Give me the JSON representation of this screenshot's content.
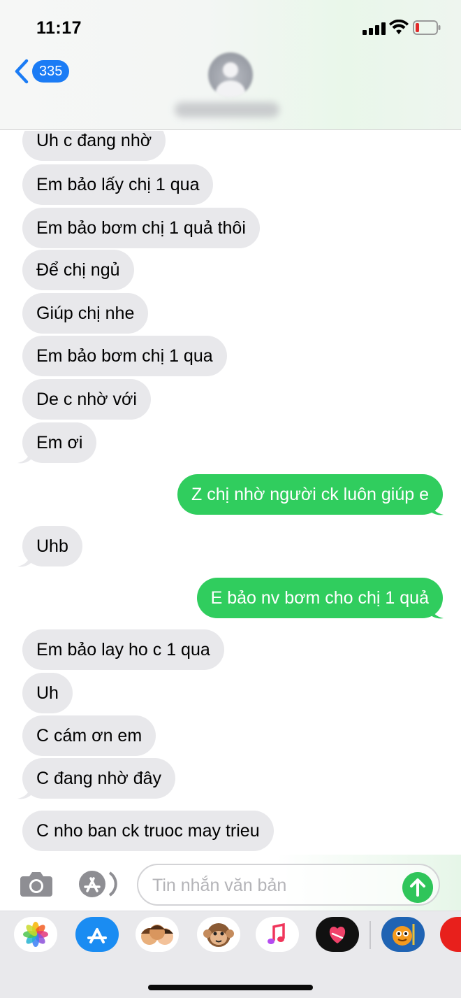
{
  "status_bar": {
    "time": "11:17"
  },
  "nav": {
    "unread_count": "335",
    "contact_name": ""
  },
  "messages": [
    {
      "text": "Uh c đang nhờ",
      "direction": "in"
    },
    {
      "text": "Em bảo lấy chị 1 qua",
      "direction": "in"
    },
    {
      "text": "Em bảo bơm chị 1 quả thôi",
      "direction": "in"
    },
    {
      "text": "Để chị ngủ",
      "direction": "in"
    },
    {
      "text": "Giúp chị nhe",
      "direction": "in"
    },
    {
      "text": "Em bảo bơm chị 1 qua",
      "direction": "in"
    },
    {
      "text": "De c nhờ với",
      "direction": "in"
    },
    {
      "text": "Em ơi",
      "direction": "in"
    },
    {
      "text": "Z chị nhờ người ck luôn giúp e",
      "direction": "out"
    },
    {
      "text": "Uhb",
      "direction": "in"
    },
    {
      "text": "E bảo nv bơm cho chị 1 quả",
      "direction": "out"
    },
    {
      "text": "Em bảo lay ho c 1 qua",
      "direction": "in"
    },
    {
      "text": "Uh",
      "direction": "in"
    },
    {
      "text": "C cám ơn em",
      "direction": "in"
    },
    {
      "text": "C đang nhờ đây",
      "direction": "in"
    },
    {
      "text": "C nho ban ck truoc may trieu",
      "direction": "in"
    }
  ],
  "composer": {
    "placeholder": "Tin nhắn văn bản"
  },
  "app_drawer": [
    "photos-app",
    "app-store-app",
    "memoji-app",
    "animoji-app",
    "music-app",
    "digital-touch-app",
    "game-app",
    "more-app"
  ],
  "colors": {
    "incoming_bubble": "#e8e8eb",
    "outgoing_bubble": "#30cd5e",
    "accent_blue": "#1b7cf5"
  }
}
